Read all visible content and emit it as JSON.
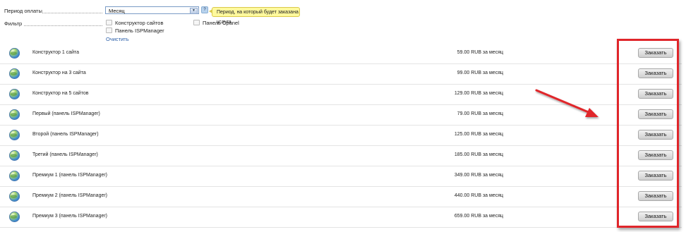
{
  "form": {
    "period_label": "Период оплаты",
    "period_value": "Месяц",
    "help_icon": "?",
    "tooltip": "Период, на который будет заказана услуга",
    "filter_label": "Фильтр",
    "filters": [
      {
        "label": "Конструктор сайтов",
        "checked": false
      },
      {
        "label": "Панель Cpanel",
        "checked": false
      },
      {
        "label": "Панель ISPManager",
        "checked": false
      }
    ],
    "clear_label": "Очистить"
  },
  "products": [
    {
      "name": "Конструктор 1 сайта",
      "price": "59.00 RUB за месяц",
      "button": "Заказать",
      "icon": "globe-icon"
    },
    {
      "name": "Конструктор на 3 сайта",
      "price": "99.00 RUB за месяц",
      "button": "Заказать",
      "icon": "globe-icon"
    },
    {
      "name": "Конструктор на 5 сайтов",
      "price": "129.00 RUB за месяц",
      "button": "Заказать",
      "icon": "globe-icon"
    },
    {
      "name": "Первый (панель ISPManager)",
      "price": "79.00 RUB за месяц",
      "button": "Заказать",
      "icon": "globe-icon"
    },
    {
      "name": "Второй (панель ISPManager)",
      "price": "125.00 RUB за месяц",
      "button": "Заказать",
      "icon": "globe-icon"
    },
    {
      "name": "Третий (панель ISPManager)",
      "price": "185.00 RUB за месяц",
      "button": "Заказать",
      "icon": "globe-icon"
    },
    {
      "name": "Премиум 1 (панель ISPManager)",
      "price": "349.00 RUB за месяц",
      "button": "Заказать",
      "icon": "globe-icon"
    },
    {
      "name": "Премиум 2 (панель ISPManager)",
      "price": "440.00 RUB за месяц",
      "button": "Заказать",
      "icon": "globe-icon"
    },
    {
      "name": "Премиум 3 (панель ISPManager)",
      "price": "659.00 RUB за месяц",
      "button": "Заказать",
      "icon": "globe-icon"
    }
  ],
  "annotation": {
    "highlight_color": "#e0262b"
  }
}
